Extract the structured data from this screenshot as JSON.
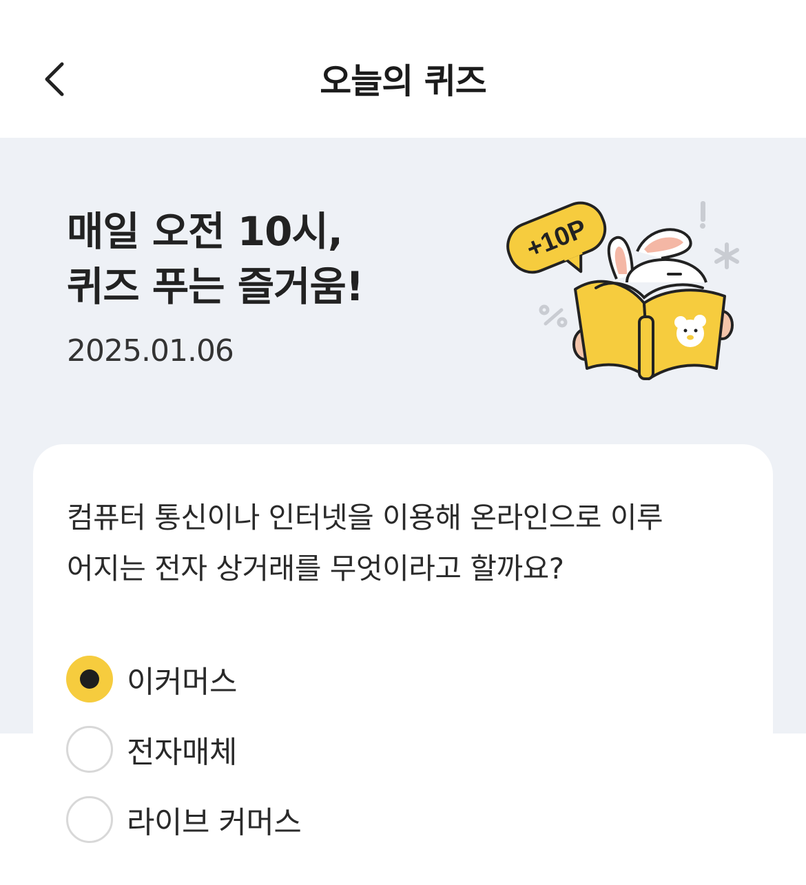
{
  "header": {
    "title": "오늘의 퀴즈",
    "back_icon": "chevron-left-icon"
  },
  "hero": {
    "heading_line1": "매일 오전 10시,",
    "heading_line2": "퀴즈 푸는 즐거움!",
    "date": "2025.01.06",
    "badge_text": "+10P",
    "accent_color": "#f6cc3e"
  },
  "quiz": {
    "question_line1": "컴퓨터 통신이나 인터넷을 이용해 온라인으로 이루",
    "question_line2": "어지는 전자 상거래를 무엇이라고 할까요?",
    "options": [
      {
        "label": "이커머스",
        "selected": true
      },
      {
        "label": "전자매체",
        "selected": false
      },
      {
        "label": "라이브 커머스",
        "selected": false
      }
    ]
  }
}
